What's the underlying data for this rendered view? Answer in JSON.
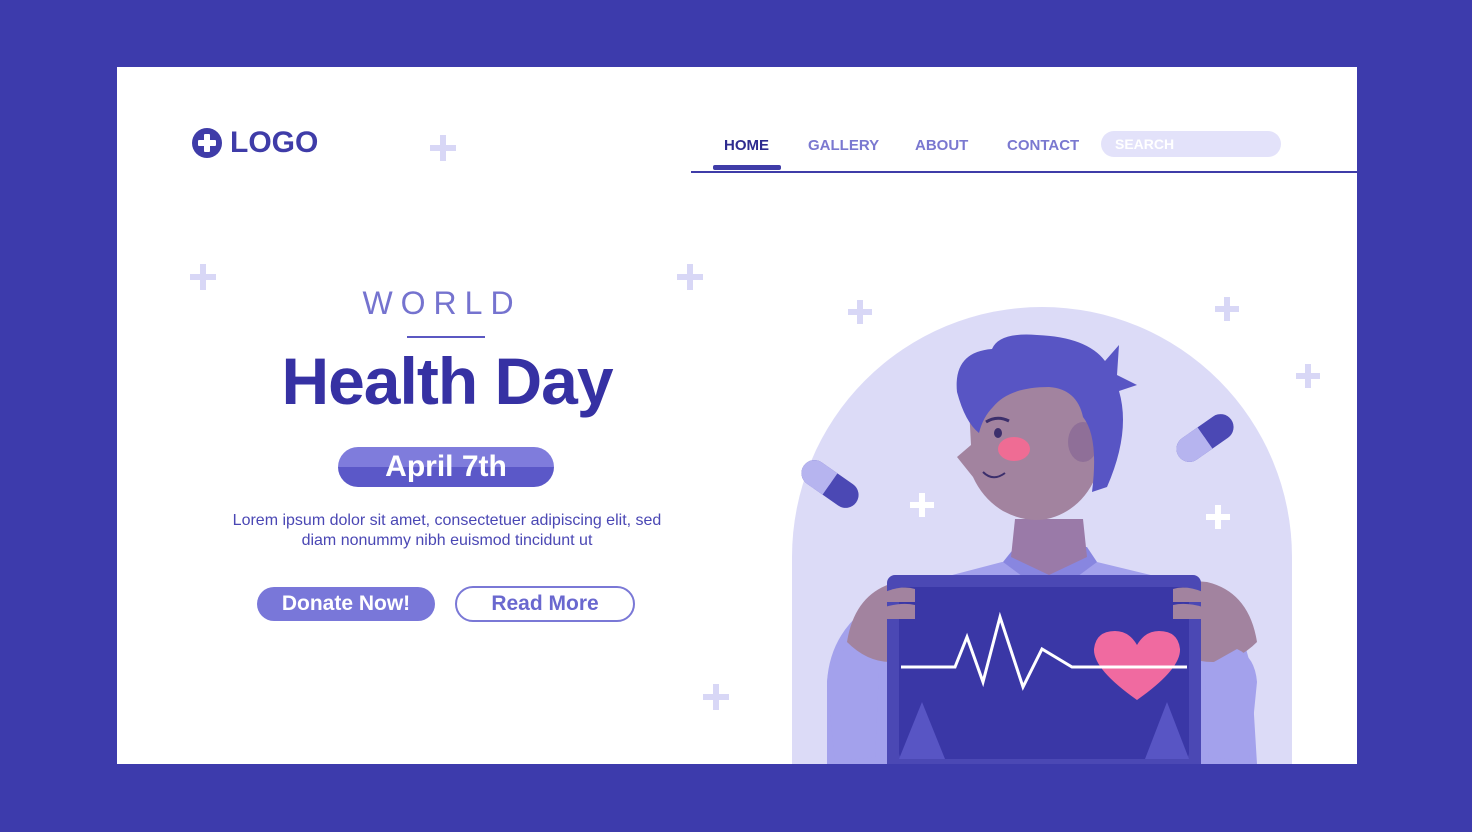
{
  "logo": {
    "text": "LOGO",
    "icon": "plus-circle-icon"
  },
  "nav": {
    "items": [
      {
        "label": "HOME",
        "active": true
      },
      {
        "label": "GALLERY",
        "active": false
      },
      {
        "label": "ABOUT",
        "active": false
      },
      {
        "label": "CONTACT",
        "active": false
      }
    ],
    "search_placeholder": "SEARCH"
  },
  "hero": {
    "kicker": "WORLD",
    "title": "Health Day",
    "date": "April 7th",
    "description": "Lorem ipsum dolor sit amet, consectetuer adipiscing elit, sed diam nonummy nibh euismod tincidunt ut",
    "primary_button": "Donate Now!",
    "secondary_button": "Read More"
  },
  "colors": {
    "frame_bg": "#3d3bac",
    "accent": "#3f3ca8",
    "light_accent": "#7977d9",
    "heart": "#f06aa0"
  },
  "illustration": {
    "subject": "person holding tablet with heartbeat and heart",
    "icons": [
      "pill-icon",
      "plus-icon",
      "heart-icon",
      "heartbeat-icon"
    ]
  }
}
